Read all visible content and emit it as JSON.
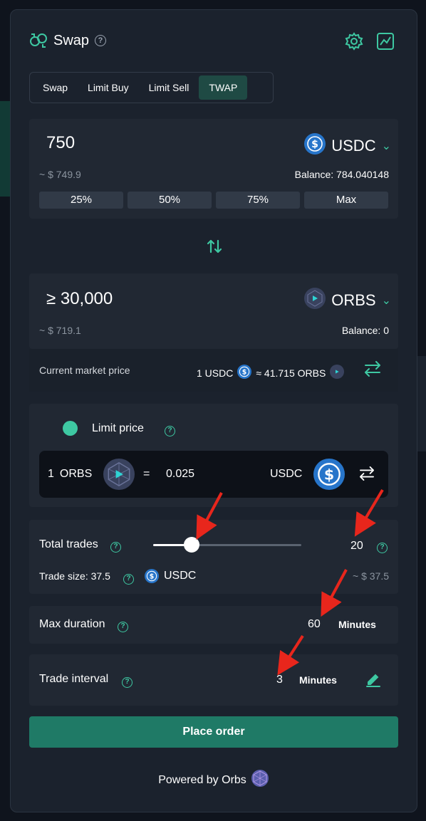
{
  "header": {
    "title": "Swap",
    "help": "?"
  },
  "tabs": [
    {
      "label": "Swap"
    },
    {
      "label": "Limit Buy"
    },
    {
      "label": "Limit Sell"
    },
    {
      "label": "TWAP"
    }
  ],
  "from": {
    "amount": "750",
    "token": "USDC",
    "usd_value": "~ $ 749.9",
    "balance": "Balance: 784.040148",
    "percent_buttons": [
      "25%",
      "50%",
      "75%",
      "Max"
    ]
  },
  "to": {
    "amount": "≥ 30,000",
    "token": "ORBS",
    "usd_value": "~ $ 719.1",
    "balance": "Balance: 0"
  },
  "market": {
    "label": "Current market price",
    "left": "1 USDC",
    "right": "≈ 41.715 ORBS"
  },
  "limit": {
    "label": "Limit price",
    "base_amount": "1",
    "base_token": "ORBS",
    "equals": "=",
    "price": "0.025",
    "quote_token": "USDC"
  },
  "trades": {
    "label": "Total trades",
    "value": "20",
    "slider_fraction": 0.26,
    "trade_size": "Trade size: 37.5",
    "trade_token": "USDC",
    "usd": "~ $ 37.5"
  },
  "duration": {
    "label": "Max duration",
    "value": "60",
    "unit": "Minutes"
  },
  "interval": {
    "label": "Trade interval",
    "value": "3",
    "unit": "Minutes"
  },
  "action": {
    "place_order": "Place order"
  },
  "footer": {
    "powered": "Powered by Orbs"
  },
  "colors": {
    "accent": "#3ec8a2",
    "button": "#1f7a66",
    "usdc": "#2775ca",
    "annotation": "#e8261c"
  }
}
